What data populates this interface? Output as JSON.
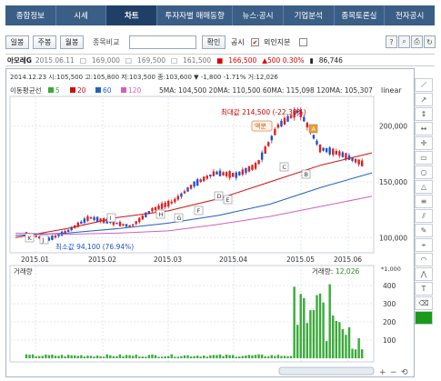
{
  "nav": {
    "tabs": [
      "종합정보",
      "시세",
      "차트",
      "투자자별 매매동향",
      "뉴스·공시",
      "기업분석",
      "종목토론실",
      "전자공시"
    ],
    "active": "차트"
  },
  "toolbar": {
    "day_label": "일봉",
    "week_label": "주봉",
    "month_label": "월봉",
    "compare_label": "종목비교",
    "compare_value": "",
    "confirm_label": "확인",
    "notice_label": "공시",
    "notice_checked": "✔",
    "foreign_label": "외인지분"
  },
  "quote": {
    "symbol": "아모레G",
    "date": "2015.06.11",
    "open": "169,000",
    "high": "169,500",
    "low": "161,500",
    "close": "166,500",
    "change": "▲500 0.30%",
    "volume": "86,746"
  },
  "chart_info": {
    "ohlc_line": "2014.12.23 시:105,500  고:105,800  저:103,500  종:103,600  ▼ -1,800  -1.71%  거:12,026",
    "ma_legend_title": "이동평균선",
    "ma_legend": [
      {
        "label": "5",
        "color": "#3aaa3a"
      },
      {
        "label": "20",
        "color": "#d01010"
      },
      {
        "label": "60",
        "color": "#2060c0"
      },
      {
        "label": "120",
        "color": "#d060c0"
      }
    ],
    "ma_values": "5MA: 104,500  20MA: 110,500  60MA: 115,098  120MA: 105,307",
    "scale_label": "linear",
    "max_label": "최대값 214,500 (-22.38%)",
    "min_label": "최소값 94,100 (76.94%)",
    "annotation": "액분",
    "wave_labels": [
      "K",
      "J",
      "I",
      "H",
      "G",
      "F",
      "E",
      "D",
      "C",
      "B",
      "A"
    ],
    "volume_title": "거래량",
    "volume_value": "12,026",
    "volume_scale": "*1,000",
    "colors": {
      "up": "#e02020",
      "down": "#2050d0",
      "volume": "#3aaa3a"
    }
  },
  "chart_data": {
    "type": "line",
    "title": "",
    "x": [
      "2015.01",
      "2015.02",
      "2015.03",
      "2015.04",
      "2015.05",
      "2015.06"
    ],
    "ylim": [
      88000,
      225000
    ],
    "yticks": [
      100000,
      150000,
      200000
    ],
    "ytick_labels": [
      "100,000",
      "150,000",
      "200,000"
    ],
    "series": [
      {
        "name": "20",
        "values": [
          100000,
          108000,
          118000,
          124000,
          135000,
          150000,
          165000,
          176000
        ]
      },
      {
        "name": "60",
        "values": [
          102000,
          104000,
          108000,
          113000,
          120000,
          130000,
          145000,
          158000
        ]
      },
      {
        "name": "120",
        "values": [
          104000,
          103000,
          104000,
          106000,
          112000,
          119000,
          128000,
          137000
        ]
      }
    ],
    "price_close": [
      103600,
      98000,
      106000,
      118000,
      114000,
      110000,
      125000,
      132000,
      148000,
      158000,
      156000,
      165000,
      200000,
      214000,
      180000,
      175000,
      166500
    ],
    "volume_yticks": [
      100,
      200,
      300,
      400
    ],
    "volume_ylim": [
      0,
      450
    ]
  },
  "side_tools": [
    "line-tool-icon",
    "ray-tool-icon",
    "vertical-line-icon",
    "horizontal-line-icon",
    "crosshair-icon",
    "rect-tool-icon",
    "circle-tool-icon",
    "triangle-tool-icon",
    "fibo-icon",
    "channel-icon",
    "pen-icon",
    "gann-icon",
    "arc-icon",
    "zigzag-icon",
    "text-tool-icon",
    "eraser-icon",
    "color-picker-icon"
  ]
}
